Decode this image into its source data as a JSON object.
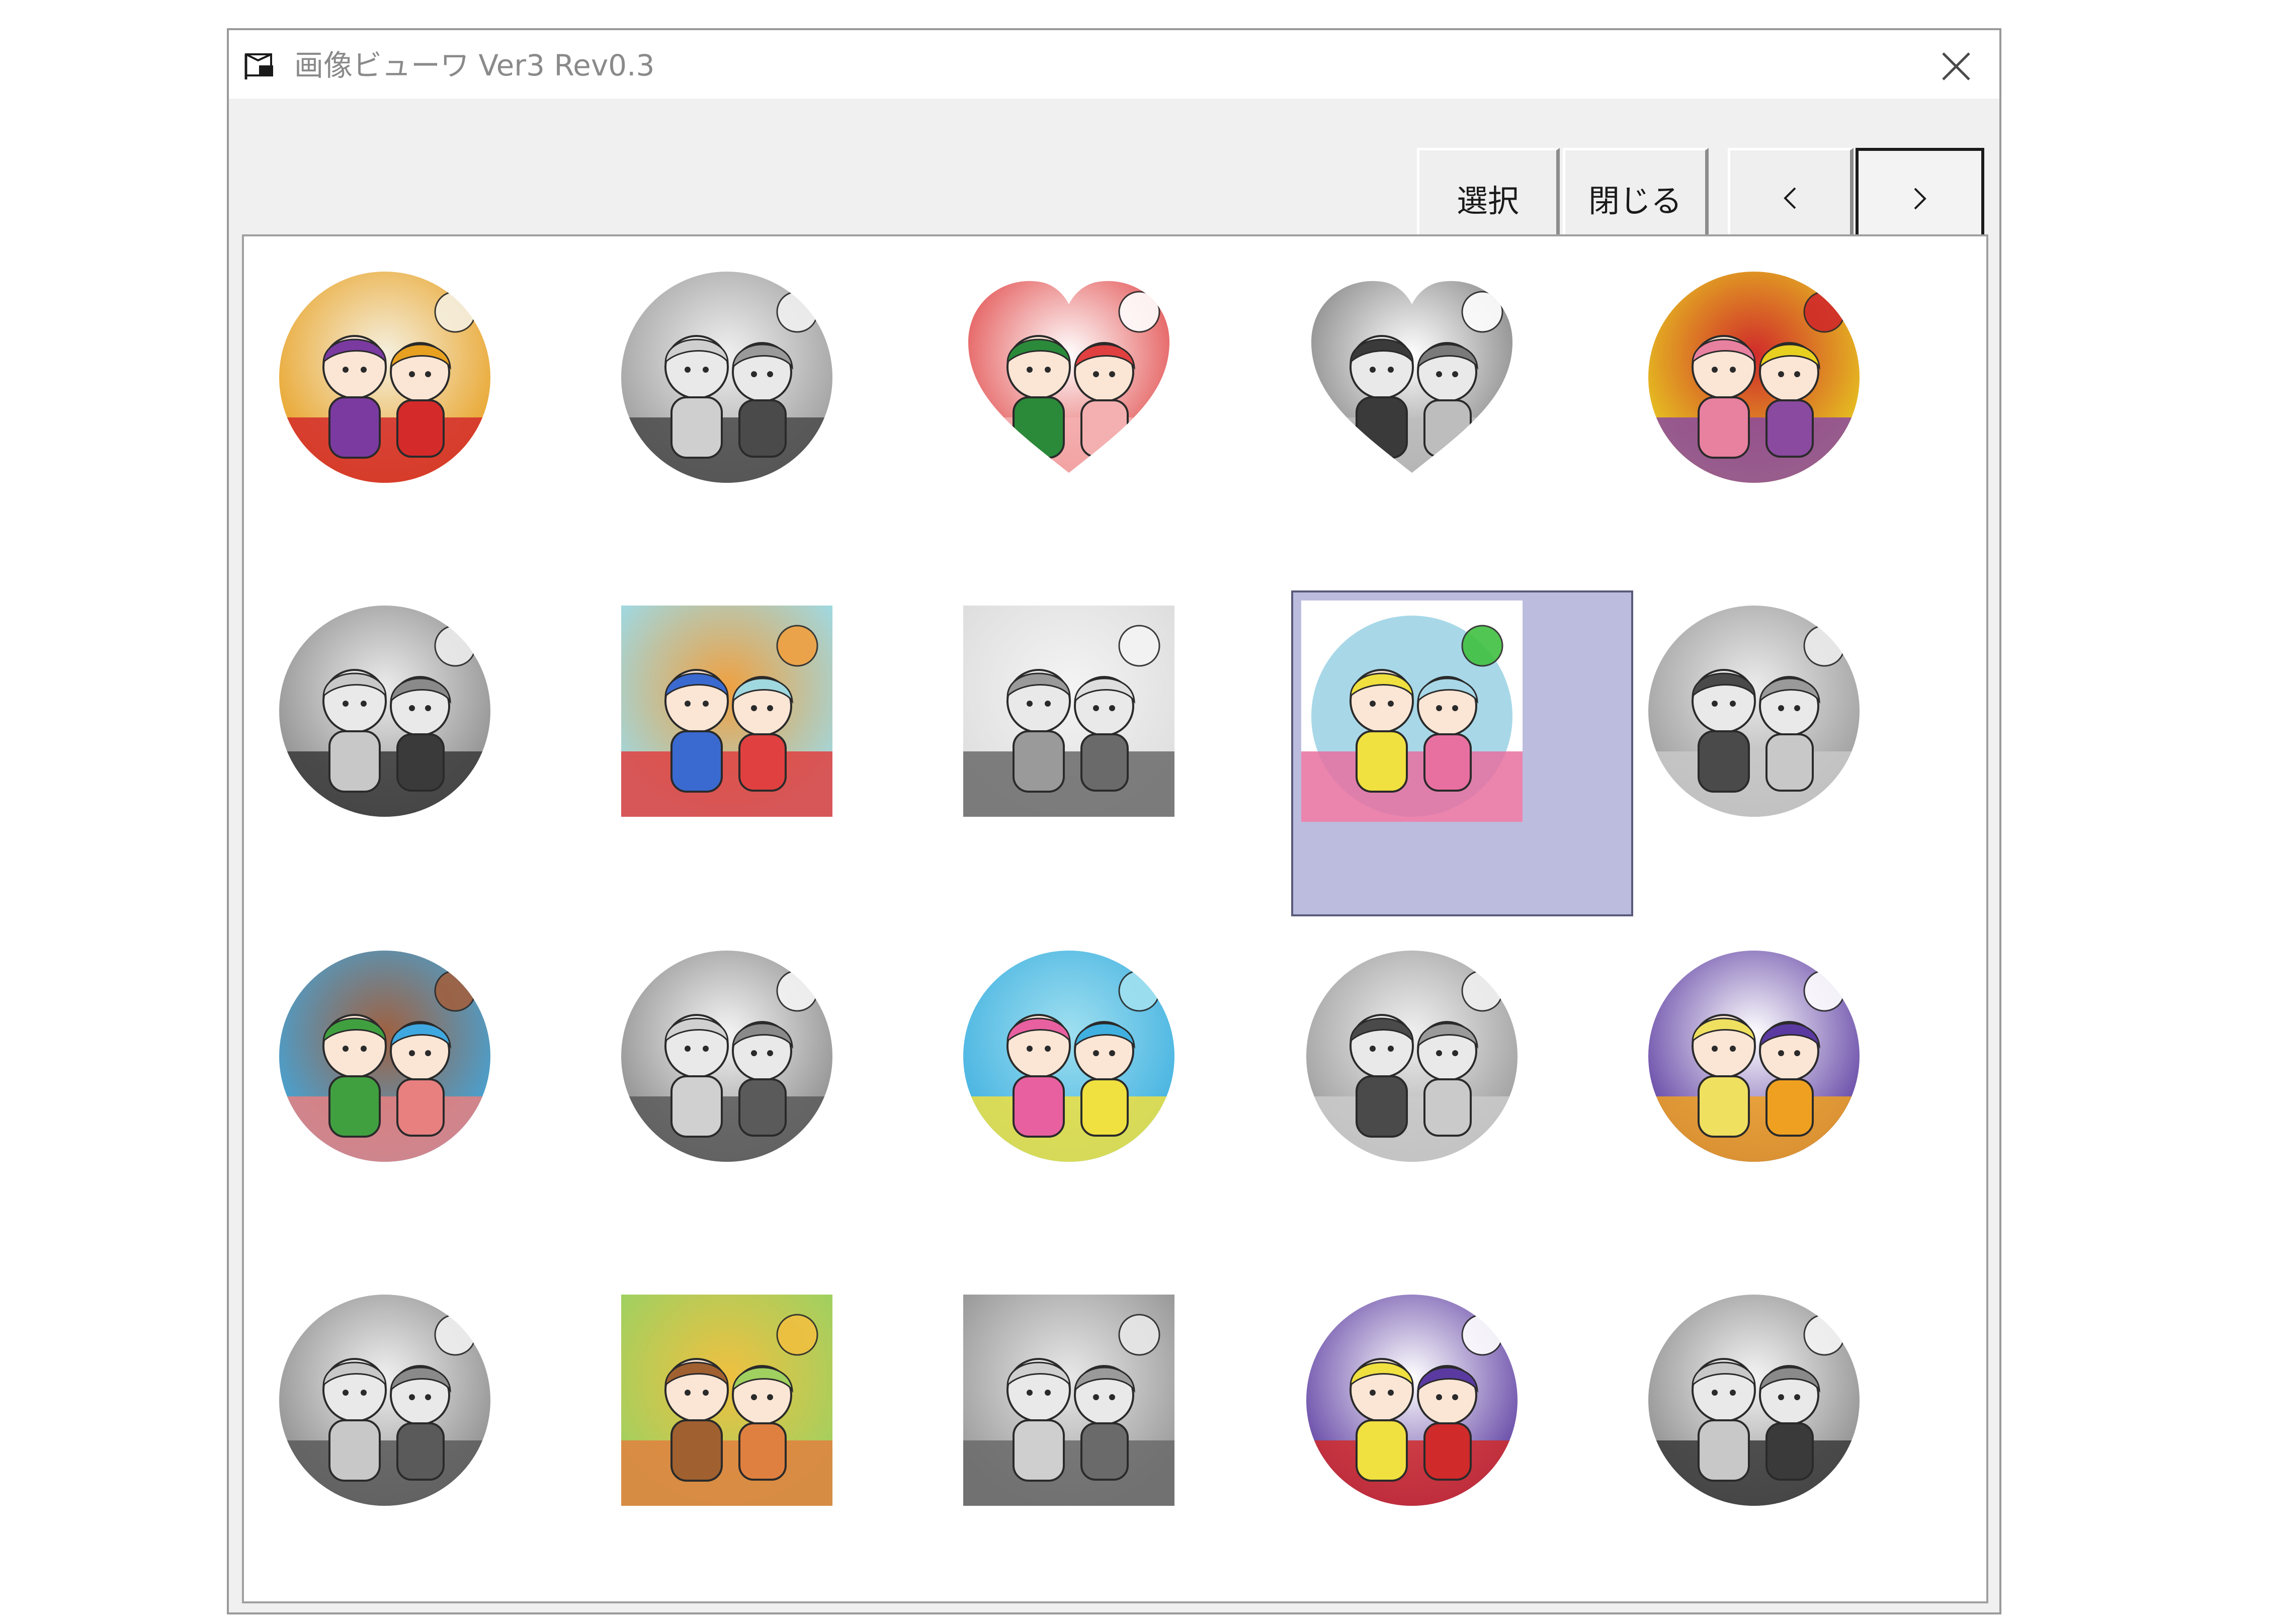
{
  "window": {
    "title": "画像ビューワ Ver3 Rev0.3"
  },
  "toolbar": {
    "select_label": "選択",
    "close_label": "閉じる"
  },
  "grid": {
    "selected_index": 8,
    "thumbnails": [
      {
        "icon": "new-year-kagamimochi-color-thumbnail",
        "style": "color",
        "shape": "circle",
        "palette": [
          "#e8a020",
          "#d42a2a",
          "#7a3aa0",
          "#f5f0e0"
        ]
      },
      {
        "icon": "new-year-kagamimochi-gray-thumbnail",
        "style": "gray",
        "shape": "circle",
        "palette": [
          "#9a9a9a",
          "#4a4a4a",
          "#cfcfcf",
          "#f0f0f0"
        ]
      },
      {
        "icon": "valentine-couple-color-thumbnail",
        "style": "color",
        "shape": "heart",
        "palette": [
          "#e04040",
          "#f4b0b0",
          "#2a8a3a",
          "#ffffff"
        ]
      },
      {
        "icon": "valentine-couple-gray-thumbnail",
        "style": "gray",
        "shape": "heart",
        "palette": [
          "#7a7a7a",
          "#bdbdbd",
          "#3a3a3a",
          "#ffffff"
        ]
      },
      {
        "icon": "hina-dolls-color-thumbnail",
        "style": "color",
        "shape": "circle",
        "palette": [
          "#e8d020",
          "#8a4aa0",
          "#e880a0",
          "#d02a2a"
        ]
      },
      {
        "icon": "hina-dolls-gray-thumbnail",
        "style": "gray",
        "shape": "circle",
        "palette": [
          "#8a8a8a",
          "#3a3a3a",
          "#c8c8c8",
          "#ececec"
        ]
      },
      {
        "icon": "koinobori-boy-color-thumbnail",
        "style": "color",
        "shape": "square",
        "palette": [
          "#a0d8e0",
          "#e04040",
          "#3a6ad0",
          "#f0a040"
        ]
      },
      {
        "icon": "koinobori-boy-gray-thumbnail",
        "style": "gray",
        "shape": "square",
        "palette": [
          "#dedede",
          "#6a6a6a",
          "#9a9a9a",
          "#f4f4f4"
        ]
      },
      {
        "icon": "rainy-girl-umbrella-color-thumbnail",
        "style": "color",
        "shape": "square",
        "palette": [
          "#a8d8e8",
          "#e870a0",
          "#f0e040",
          "#40c040"
        ]
      },
      {
        "icon": "rainy-girl-umbrella-gray-thumbnail",
        "style": "gray",
        "shape": "circle",
        "palette": [
          "#9a9a9a",
          "#c8c8c8",
          "#4a4a4a",
          "#ececec"
        ]
      },
      {
        "icon": "tanabata-couple-color-thumbnail",
        "style": "color",
        "shape": "circle",
        "palette": [
          "#40a8e0",
          "#e88080",
          "#40a040",
          "#a06040"
        ]
      },
      {
        "icon": "tanabata-couple-gray-thumbnail",
        "style": "gray",
        "shape": "circle",
        "palette": [
          "#8a8a8a",
          "#5a5a5a",
          "#d0d0d0",
          "#f4f4f4"
        ]
      },
      {
        "icon": "summer-dolphin-girl-color-thumbnail",
        "style": "color",
        "shape": "circle",
        "palette": [
          "#40b0e0",
          "#f0e040",
          "#e860a0",
          "#a0e0f0"
        ]
      },
      {
        "icon": "summer-dolphin-girl-gray-thumbnail",
        "style": "gray",
        "shape": "circle",
        "palette": [
          "#9a9a9a",
          "#cacaca",
          "#4a4a4a",
          "#f0f0f0"
        ]
      },
      {
        "icon": "halloween-ghost-color-thumbnail",
        "style": "color",
        "shape": "circle",
        "palette": [
          "#5a3aa0",
          "#f0a020",
          "#f0e060",
          "#ffffff"
        ]
      },
      {
        "icon": "halloween-ghost-gray-thumbnail",
        "style": "gray",
        "shape": "circle",
        "palette": [
          "#8a8a8a",
          "#5a5a5a",
          "#c8c8c8",
          "#f0f0f0"
        ]
      },
      {
        "icon": "autumn-bear-squirrel-color-thumbnail",
        "style": "color",
        "shape": "square",
        "palette": [
          "#a0d060",
          "#e08040",
          "#a06030",
          "#f0c040"
        ]
      },
      {
        "icon": "autumn-bear-squirrel-gray-thumbnail",
        "style": "gray",
        "shape": "square",
        "palette": [
          "#9a9a9a",
          "#6a6a6a",
          "#cfcfcf",
          "#e8e8e8"
        ]
      },
      {
        "icon": "christmas-santa-color-thumbnail",
        "style": "color",
        "shape": "circle",
        "palette": [
          "#5a3aa0",
          "#d02a2a",
          "#f0e040",
          "#ffffff"
        ]
      },
      {
        "icon": "christmas-santa-gray-thumbnail",
        "style": "gray",
        "shape": "circle",
        "palette": [
          "#8a8a8a",
          "#3a3a3a",
          "#c8c8c8",
          "#f4f4f4"
        ]
      }
    ]
  }
}
